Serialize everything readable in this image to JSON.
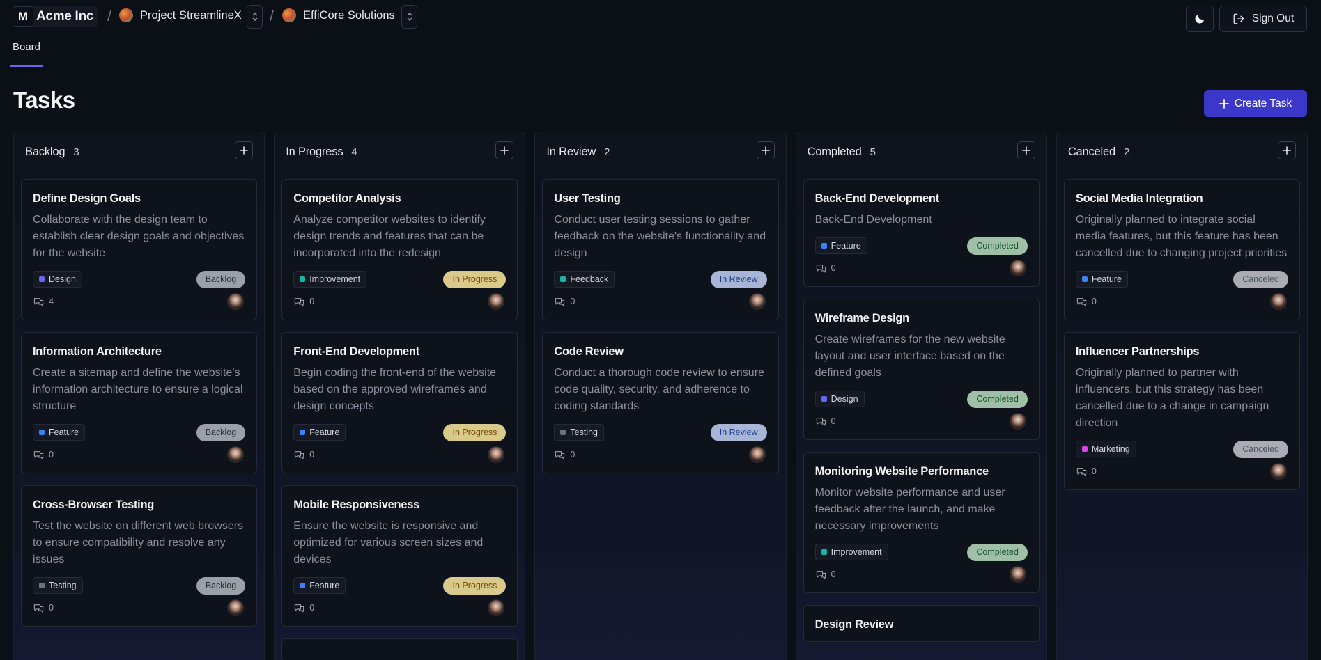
{
  "header": {
    "org_logo_letter": "M",
    "org_name": "Acme Inc",
    "separator": "/",
    "project": "Project StreamlineX",
    "client": "EffiCore Solutions",
    "signout_label": "Sign Out",
    "theme_icon": "moon-icon"
  },
  "tabs": [
    {
      "label": "Board",
      "active": true
    }
  ],
  "page": {
    "title": "Tasks",
    "create_label": "Create Task"
  },
  "tag_colors": {
    "Design": "#6366f1",
    "Feature": "#3b82f6",
    "Testing": "#6b7280",
    "Improvement": "#14b8a6",
    "Feedback": "#14b8a6",
    "Marketing": "#d946ef"
  },
  "status_styles": {
    "Backlog": {
      "bg": "#9aa0a8",
      "fg": "#1f2937"
    },
    "In Progress": {
      "bg": "#d9c98a",
      "fg": "#7a4a09"
    },
    "In Review": {
      "bg": "#a7b6d6",
      "fg": "#1e3a8a"
    },
    "Completed": {
      "bg": "#9fbfa7",
      "fg": "#14532d"
    },
    "Canceled": {
      "bg": "#a9adb3",
      "fg": "#4b5563"
    }
  },
  "columns": [
    {
      "title": "Backlog",
      "count": "3",
      "cards": [
        {
          "title": "Define Design Goals",
          "desc": "Collaborate with the design team to establish clear design goals and objectives for the website",
          "tag": "Design",
          "status": "Backlog",
          "comments": "4"
        },
        {
          "title": "Information Architecture",
          "desc": "Create a sitemap and define the website's information architecture to ensure a logical structure",
          "tag": "Feature",
          "status": "Backlog",
          "comments": "0"
        },
        {
          "title": "Cross-Browser Testing",
          "desc": "Test the website on different web browsers to ensure compatibility and resolve any issues",
          "tag": "Testing",
          "status": "Backlog",
          "comments": "0"
        }
      ]
    },
    {
      "title": "In Progress",
      "count": "4",
      "cards": [
        {
          "title": "Competitor Analysis",
          "desc": "Analyze competitor websites to identify design trends and features that can be incorporated into the redesign",
          "tag": "Improvement",
          "status": "In Progress",
          "comments": "0"
        },
        {
          "title": "Front-End Development",
          "desc": "Begin coding the front-end of the website based on the approved wireframes and design concepts",
          "tag": "Feature",
          "status": "In Progress",
          "comments": "0"
        },
        {
          "title": "Mobile Responsiveness",
          "desc": "Ensure the website is responsive and optimized for various screen sizes and devices",
          "tag": "Feature",
          "status": "In Progress",
          "comments": "0"
        },
        {
          "title": "",
          "desc": "",
          "tag": "",
          "status": "",
          "comments": ""
        }
      ]
    },
    {
      "title": "In Review",
      "count": "2",
      "cards": [
        {
          "title": "User Testing",
          "desc": "Conduct user testing sessions to gather feedback on the website's functionality and design",
          "tag": "Feedback",
          "status": "In Review",
          "comments": "0"
        },
        {
          "title": "Code Review",
          "desc": "Conduct a thorough code review to ensure code quality, security, and adherence to coding standards",
          "tag": "Testing",
          "status": "In Review",
          "comments": "0"
        }
      ]
    },
    {
      "title": "Completed",
      "count": "5",
      "cards": [
        {
          "title": "Back-End Development",
          "desc": "Back-End Development",
          "tag": "Feature",
          "status": "Completed",
          "comments": "0"
        },
        {
          "title": "Wireframe Design",
          "desc": "Create wireframes for the new website layout and user interface based on the defined goals",
          "tag": "Design",
          "status": "Completed",
          "comments": "0"
        },
        {
          "title": "Monitoring Website Performance",
          "desc": "Monitor website performance and user feedback after the launch, and make necessary improvements",
          "tag": "Improvement",
          "status": "Completed",
          "comments": "0"
        },
        {
          "title": "Design Review",
          "desc": "",
          "tag": "",
          "status": "",
          "comments": ""
        }
      ]
    },
    {
      "title": "Canceled",
      "count": "2",
      "cards": [
        {
          "title": "Social Media Integration",
          "desc": "Originally planned to integrate social media features, but this feature has been cancelled due to changing project priorities",
          "tag": "Feature",
          "status": "Canceled",
          "comments": "0"
        },
        {
          "title": "Influencer Partnerships",
          "desc": "Originally planned to partner with influencers, but this strategy has been cancelled due to a change in campaign direction",
          "tag": "Marketing",
          "status": "Canceled",
          "comments": "0"
        }
      ]
    }
  ]
}
